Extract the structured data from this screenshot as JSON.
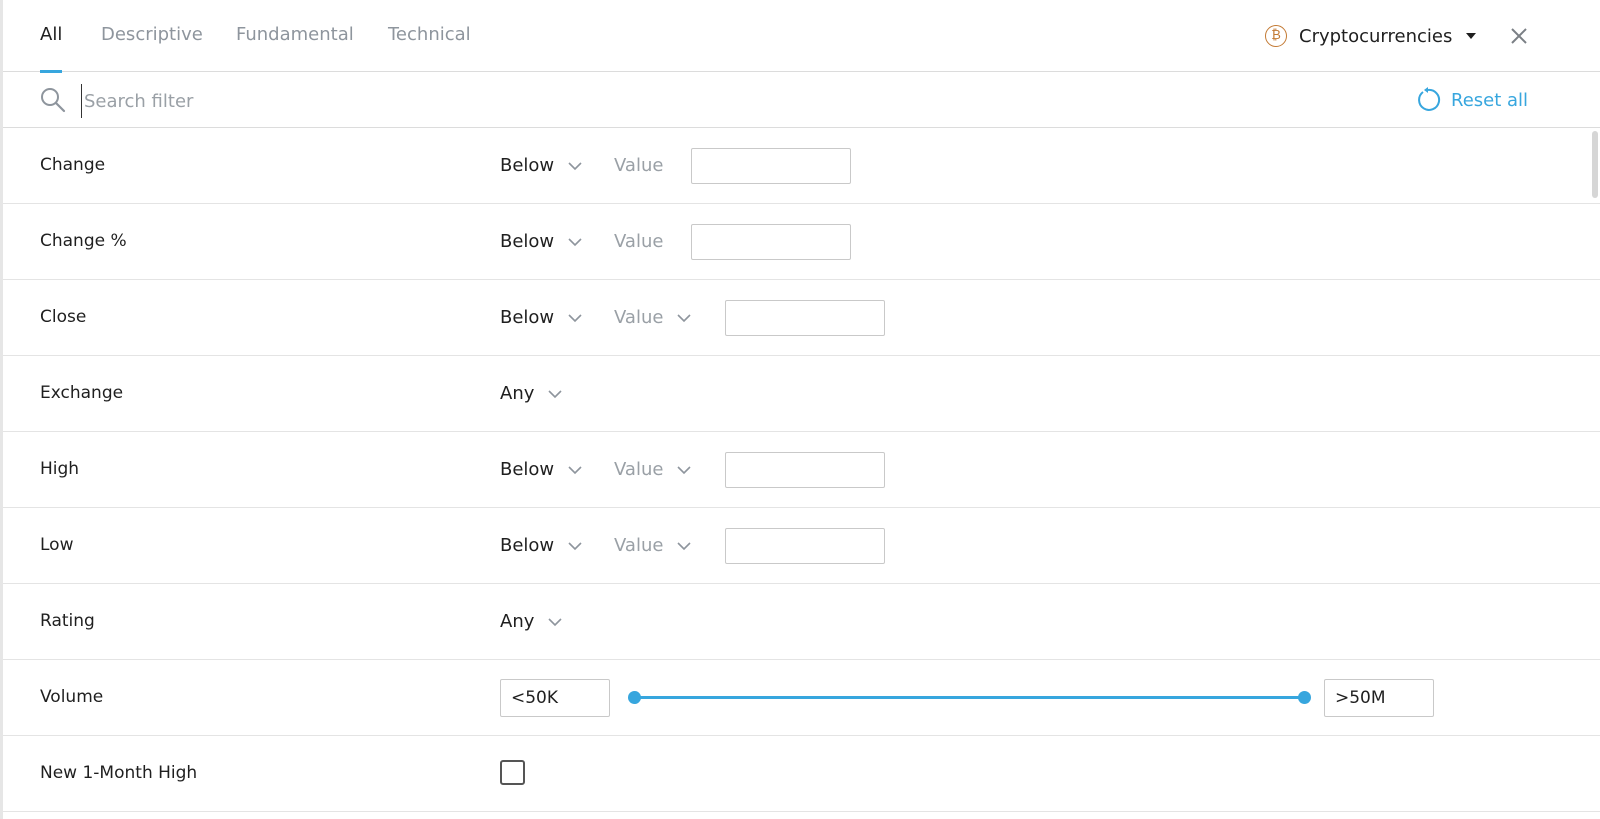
{
  "tabs": [
    {
      "label": "All",
      "active": true
    },
    {
      "label": "Descriptive",
      "active": false
    },
    {
      "label": "Fundamental",
      "active": false
    },
    {
      "label": "Technical",
      "active": false
    }
  ],
  "market": {
    "label": "Cryptocurrencies",
    "icon": "bitcoin-icon",
    "coin_glyph": "₿"
  },
  "search": {
    "placeholder": "Search filter",
    "value": ""
  },
  "reset": {
    "label": "Reset all"
  },
  "colors": {
    "accent": "#37a6de",
    "coin": "#c37a34",
    "muted": "#9aa0a6"
  },
  "filters": [
    {
      "label": "Change",
      "condition": "Below",
      "value_label": "Value"
    },
    {
      "label": "Change %",
      "condition": "Below",
      "value_label": "Value"
    },
    {
      "label": "Close",
      "condition": "Below",
      "value_label": "Value"
    },
    {
      "label": "Exchange",
      "condition": "Any"
    },
    {
      "label": "High",
      "condition": "Below",
      "value_label": "Value"
    },
    {
      "label": "Low",
      "condition": "Below",
      "value_label": "Value"
    },
    {
      "label": "Rating",
      "condition": "Any"
    },
    {
      "label": "Volume",
      "range_min": "<50K",
      "range_max": ">50M",
      "range_low_fraction": 0,
      "range_high_fraction": 1
    },
    {
      "label": "New 1-Month High",
      "checked": false
    }
  ]
}
